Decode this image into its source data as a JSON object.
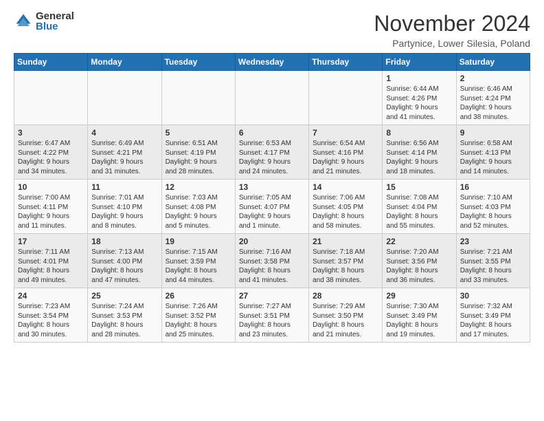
{
  "logo": {
    "general": "General",
    "blue": "Blue"
  },
  "title": "November 2024",
  "location": "Partynice, Lower Silesia, Poland",
  "weekdays": [
    "Sunday",
    "Monday",
    "Tuesday",
    "Wednesday",
    "Thursday",
    "Friday",
    "Saturday"
  ],
  "weeks": [
    [
      {
        "day": "",
        "info": ""
      },
      {
        "day": "",
        "info": ""
      },
      {
        "day": "",
        "info": ""
      },
      {
        "day": "",
        "info": ""
      },
      {
        "day": "",
        "info": ""
      },
      {
        "day": "1",
        "info": "Sunrise: 6:44 AM\nSunset: 4:26 PM\nDaylight: 9 hours\nand 41 minutes."
      },
      {
        "day": "2",
        "info": "Sunrise: 6:46 AM\nSunset: 4:24 PM\nDaylight: 9 hours\nand 38 minutes."
      }
    ],
    [
      {
        "day": "3",
        "info": "Sunrise: 6:47 AM\nSunset: 4:22 PM\nDaylight: 9 hours\nand 34 minutes."
      },
      {
        "day": "4",
        "info": "Sunrise: 6:49 AM\nSunset: 4:21 PM\nDaylight: 9 hours\nand 31 minutes."
      },
      {
        "day": "5",
        "info": "Sunrise: 6:51 AM\nSunset: 4:19 PM\nDaylight: 9 hours\nand 28 minutes."
      },
      {
        "day": "6",
        "info": "Sunrise: 6:53 AM\nSunset: 4:17 PM\nDaylight: 9 hours\nand 24 minutes."
      },
      {
        "day": "7",
        "info": "Sunrise: 6:54 AM\nSunset: 4:16 PM\nDaylight: 9 hours\nand 21 minutes."
      },
      {
        "day": "8",
        "info": "Sunrise: 6:56 AM\nSunset: 4:14 PM\nDaylight: 9 hours\nand 18 minutes."
      },
      {
        "day": "9",
        "info": "Sunrise: 6:58 AM\nSunset: 4:13 PM\nDaylight: 9 hours\nand 14 minutes."
      }
    ],
    [
      {
        "day": "10",
        "info": "Sunrise: 7:00 AM\nSunset: 4:11 PM\nDaylight: 9 hours\nand 11 minutes."
      },
      {
        "day": "11",
        "info": "Sunrise: 7:01 AM\nSunset: 4:10 PM\nDaylight: 9 hours\nand 8 minutes."
      },
      {
        "day": "12",
        "info": "Sunrise: 7:03 AM\nSunset: 4:08 PM\nDaylight: 9 hours\nand 5 minutes."
      },
      {
        "day": "13",
        "info": "Sunrise: 7:05 AM\nSunset: 4:07 PM\nDaylight: 9 hours\nand 1 minute."
      },
      {
        "day": "14",
        "info": "Sunrise: 7:06 AM\nSunset: 4:05 PM\nDaylight: 8 hours\nand 58 minutes."
      },
      {
        "day": "15",
        "info": "Sunrise: 7:08 AM\nSunset: 4:04 PM\nDaylight: 8 hours\nand 55 minutes."
      },
      {
        "day": "16",
        "info": "Sunrise: 7:10 AM\nSunset: 4:03 PM\nDaylight: 8 hours\nand 52 minutes."
      }
    ],
    [
      {
        "day": "17",
        "info": "Sunrise: 7:11 AM\nSunset: 4:01 PM\nDaylight: 8 hours\nand 49 minutes."
      },
      {
        "day": "18",
        "info": "Sunrise: 7:13 AM\nSunset: 4:00 PM\nDaylight: 8 hours\nand 47 minutes."
      },
      {
        "day": "19",
        "info": "Sunrise: 7:15 AM\nSunset: 3:59 PM\nDaylight: 8 hours\nand 44 minutes."
      },
      {
        "day": "20",
        "info": "Sunrise: 7:16 AM\nSunset: 3:58 PM\nDaylight: 8 hours\nand 41 minutes."
      },
      {
        "day": "21",
        "info": "Sunrise: 7:18 AM\nSunset: 3:57 PM\nDaylight: 8 hours\nand 38 minutes."
      },
      {
        "day": "22",
        "info": "Sunrise: 7:20 AM\nSunset: 3:56 PM\nDaylight: 8 hours\nand 36 minutes."
      },
      {
        "day": "23",
        "info": "Sunrise: 7:21 AM\nSunset: 3:55 PM\nDaylight: 8 hours\nand 33 minutes."
      }
    ],
    [
      {
        "day": "24",
        "info": "Sunrise: 7:23 AM\nSunset: 3:54 PM\nDaylight: 8 hours\nand 30 minutes."
      },
      {
        "day": "25",
        "info": "Sunrise: 7:24 AM\nSunset: 3:53 PM\nDaylight: 8 hours\nand 28 minutes."
      },
      {
        "day": "26",
        "info": "Sunrise: 7:26 AM\nSunset: 3:52 PM\nDaylight: 8 hours\nand 25 minutes."
      },
      {
        "day": "27",
        "info": "Sunrise: 7:27 AM\nSunset: 3:51 PM\nDaylight: 8 hours\nand 23 minutes."
      },
      {
        "day": "28",
        "info": "Sunrise: 7:29 AM\nSunset: 3:50 PM\nDaylight: 8 hours\nand 21 minutes."
      },
      {
        "day": "29",
        "info": "Sunrise: 7:30 AM\nSunset: 3:49 PM\nDaylight: 8 hours\nand 19 minutes."
      },
      {
        "day": "30",
        "info": "Sunrise: 7:32 AM\nSunset: 3:49 PM\nDaylight: 8 hours\nand 17 minutes."
      }
    ]
  ]
}
